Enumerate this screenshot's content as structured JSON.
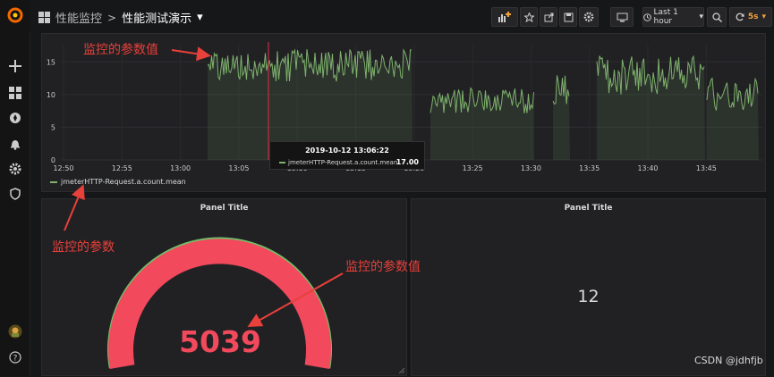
{
  "breadcrumb": {
    "folder": "性能监控",
    "separator": ">",
    "dashboard": "性能测试演示",
    "caret": "▾"
  },
  "toolbar": {
    "time_range": "Last 1 hour",
    "refresh_interval": "5s"
  },
  "graph": {
    "y_ticks": [
      "0",
      "5",
      "10",
      "15"
    ],
    "x_ticks": [
      "12:50",
      "12:55",
      "13:00",
      "13:05",
      "13:10",
      "13:15",
      "13:20",
      "13:25",
      "13:30",
      "13:35",
      "13:40",
      "13:45"
    ],
    "legend": "jmeterHTTP-Request.a.count.mean",
    "tooltip": {
      "time": "2019-10-12 13:06:22",
      "series": "jmeterHTTP-Request.a.count.mean:",
      "value": "17.00"
    },
    "series_color": "#7eb26d"
  },
  "gauge_panel": {
    "title": "Panel Title",
    "value": "5039",
    "value_color": "#f2495c",
    "threshold_color": "#73bf69"
  },
  "stat_panel": {
    "title": "Panel Title",
    "value": "12"
  },
  "annotations": {
    "top": "监控的参数值",
    "bottom_left": "监控的参数",
    "middle": "监控的参数值"
  },
  "watermark": "CSDN @jdhfjb"
}
